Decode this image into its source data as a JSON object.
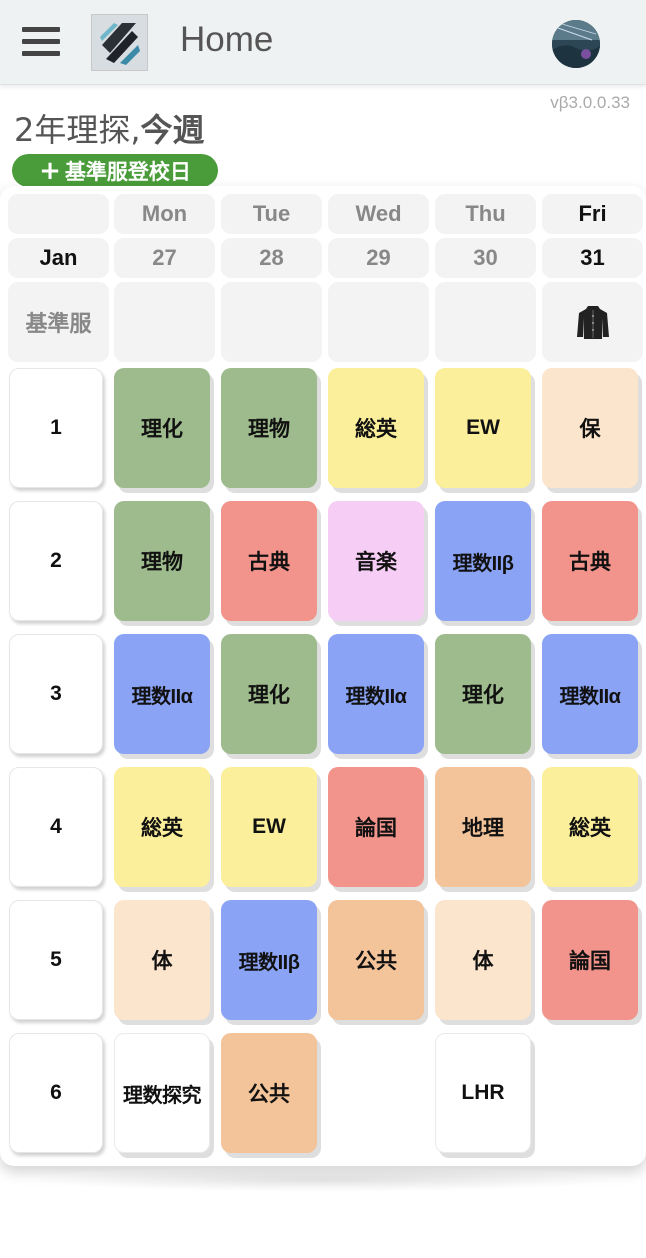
{
  "app_bar": {
    "menu_icon": "hamburger-icon",
    "logo_icon": "app-logo",
    "title": "Home",
    "avatar_icon": "user-avatar"
  },
  "version": "vβ3.0.0.33",
  "heading": {
    "class_name": "2年理探",
    "separator": ",",
    "week_label": "今週"
  },
  "add_button": {
    "icon": "plus-icon",
    "label": "基準服登校日"
  },
  "timetable": {
    "days": [
      {
        "name": "Mon",
        "active": false
      },
      {
        "name": "Tue",
        "active": false
      },
      {
        "name": "Wed",
        "active": false
      },
      {
        "name": "Thu",
        "active": false
      },
      {
        "name": "Fri",
        "active": true
      }
    ],
    "month": "Jan",
    "dates": [
      "27",
      "28",
      "29",
      "30",
      "31"
    ],
    "uniform_label": "基準服",
    "uniform_icon": "school-uniform-icon",
    "uniform_days": [
      false,
      false,
      false,
      false,
      true
    ],
    "periods": [
      "1",
      "2",
      "3",
      "4",
      "5",
      "6"
    ],
    "grid": [
      [
        "理化",
        "理物",
        "理物",
        "古典",
        "理数IIα",
        "理化",
        "総英",
        "EW",
        "体",
        "理数IIβ"
      ],
      []
    ],
    "rows": [
      [
        {
          "label": "理化",
          "color": "#9dbb8c"
        },
        {
          "label": "理物",
          "color": "#9dbb8c"
        },
        {
          "label": "総英",
          "color": "#fcef9b"
        },
        {
          "label": "EW",
          "color": "#fcef9b"
        },
        {
          "label": "保",
          "color": "#fbe5cc"
        }
      ],
      [
        {
          "label": "理物",
          "color": "#9dbb8c"
        },
        {
          "label": "古典",
          "color": "#f2948c"
        },
        {
          "label": "音楽",
          "color": "#f5cdf5"
        },
        {
          "label": "理数IIβ",
          "color": "#8aa3f5"
        },
        {
          "label": "古典",
          "color": "#f2948c"
        }
      ],
      [
        {
          "label": "理数IIα",
          "color": "#8aa3f5"
        },
        {
          "label": "理化",
          "color": "#9dbb8c"
        },
        {
          "label": "理数IIα",
          "color": "#8aa3f5"
        },
        {
          "label": "理化",
          "color": "#9dbb8c"
        },
        {
          "label": "理数IIα",
          "color": "#8aa3f5"
        }
      ],
      [
        {
          "label": "総英",
          "color": "#fcef9b"
        },
        {
          "label": "EW",
          "color": "#fcef9b"
        },
        {
          "label": "論国",
          "color": "#f2948c"
        },
        {
          "label": "地理",
          "color": "#f3c39a"
        },
        {
          "label": "総英",
          "color": "#fcef9b"
        }
      ],
      [
        {
          "label": "体",
          "color": "#fbe5cc"
        },
        {
          "label": "理数IIβ",
          "color": "#8aa3f5"
        },
        {
          "label": "公共",
          "color": "#f3c39a"
        },
        {
          "label": "体",
          "color": "#fbe5cc"
        },
        {
          "label": "論国",
          "color": "#f2948c"
        }
      ],
      [
        {
          "label": "理数探究",
          "color": "#ffffff"
        },
        {
          "label": "公共",
          "color": "#f3c39a"
        },
        null,
        {
          "label": "LHR",
          "color": "#ffffff"
        },
        null
      ]
    ]
  }
}
